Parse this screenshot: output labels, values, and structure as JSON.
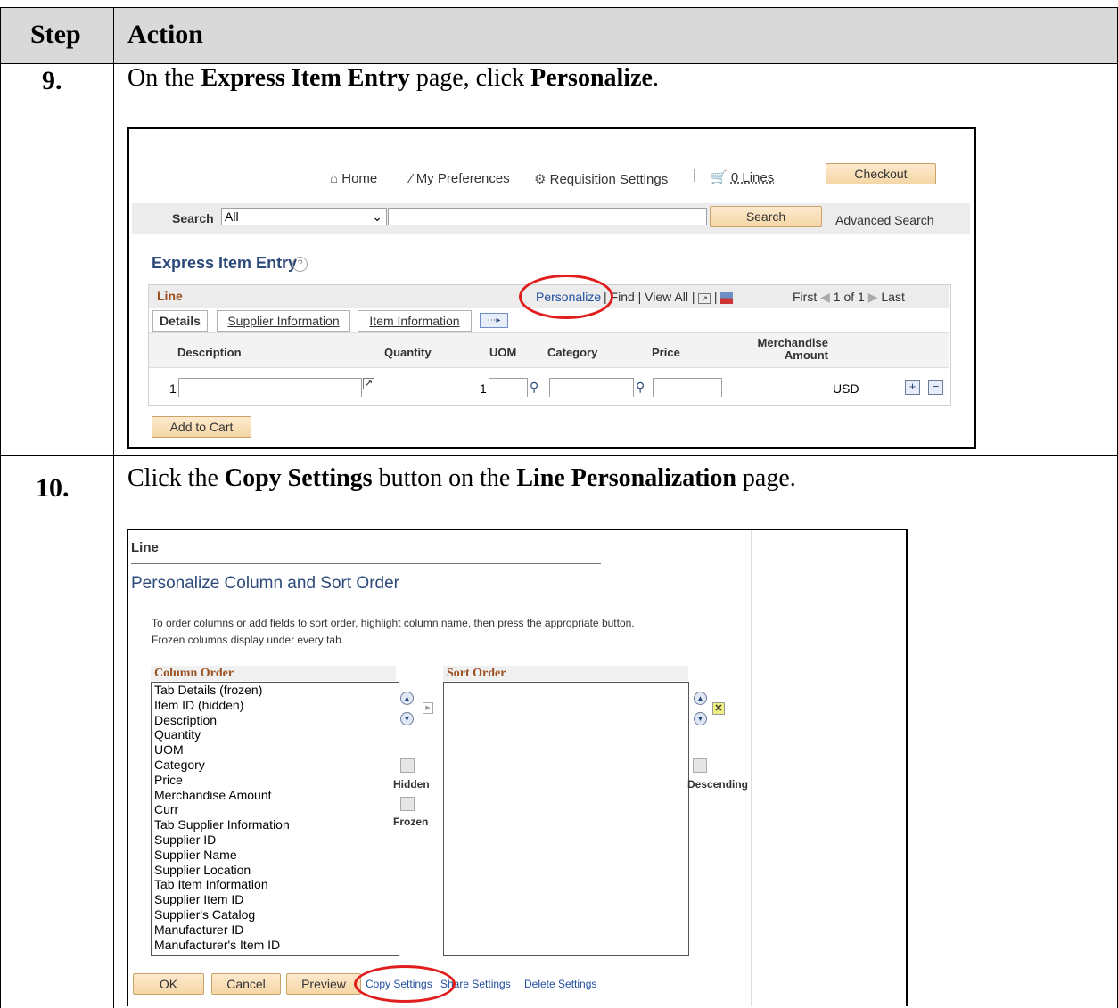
{
  "table_header": {
    "step": "Step",
    "action": "Action"
  },
  "steps": [
    {
      "number": "9.",
      "text_prefix": "On the ",
      "bold1": "Express Item Entry",
      "text_mid": " page, click ",
      "bold2": "Personalize",
      "text_suffix": "."
    },
    {
      "number": "10.",
      "text_prefix": "Click the ",
      "bold1": "Copy Settings",
      "text_mid": " button on the ",
      "bold2": "Line Personalization",
      "text_suffix": " page."
    }
  ],
  "shot1": {
    "nav": {
      "home": "Home",
      "prefs": "My Preferences",
      "req": "Requisition Settings",
      "sep": "|",
      "lines": "0 Lines",
      "checkout": "Checkout"
    },
    "search": {
      "label": "Search",
      "select_value": "All",
      "button": "Search",
      "advanced": "Advanced Search"
    },
    "page_title": "Express Item Entry",
    "help": "?",
    "grid": {
      "title": "Line",
      "personalize": "Personalize",
      "links": "| Find | View All |",
      "pipe": "|",
      "first": "First",
      "range": "1 of 1",
      "last": "Last",
      "tabs": [
        "Details",
        "Supplier Information",
        "Item Information"
      ],
      "columns": {
        "description": "Description",
        "quantity": "Quantity",
        "uom": "UOM",
        "category": "Category",
        "price": "Price",
        "merch1": "Merchandise",
        "merch2": "Amount"
      },
      "row": {
        "num": "1",
        "qty": "1",
        "curr": "USD"
      },
      "add_to_cart": "Add to Cart"
    }
  },
  "shot2": {
    "title": "Line",
    "heading": "Personalize Column and Sort Order",
    "instructions1": "To order columns or add fields to sort order, highlight column name, then press the appropriate button.",
    "instructions2": "Frozen columns display under every tab.",
    "column_order_label": "Column Order",
    "sort_order_label": "Sort Order",
    "columns": [
      "Tab Details (frozen)",
      "Item ID (hidden)",
      "Description",
      "Quantity",
      "UOM",
      "Category",
      "Price",
      "Merchandise Amount",
      "Curr",
      "Tab Supplier Information",
      "Supplier ID",
      "Supplier Name",
      "Supplier Location",
      "Tab Item Information",
      "Supplier Item ID",
      "Supplier's Catalog",
      "Manufacturer ID",
      "Manufacturer's Item ID"
    ],
    "hidden": "Hidden",
    "frozen": "Frozen",
    "descending": "Descending",
    "buttons": {
      "ok": "OK",
      "cancel": "Cancel",
      "preview": "Preview"
    },
    "links": {
      "copy": "Copy Settings",
      "share": "Share Settings",
      "delete": "Delete Settings"
    }
  }
}
